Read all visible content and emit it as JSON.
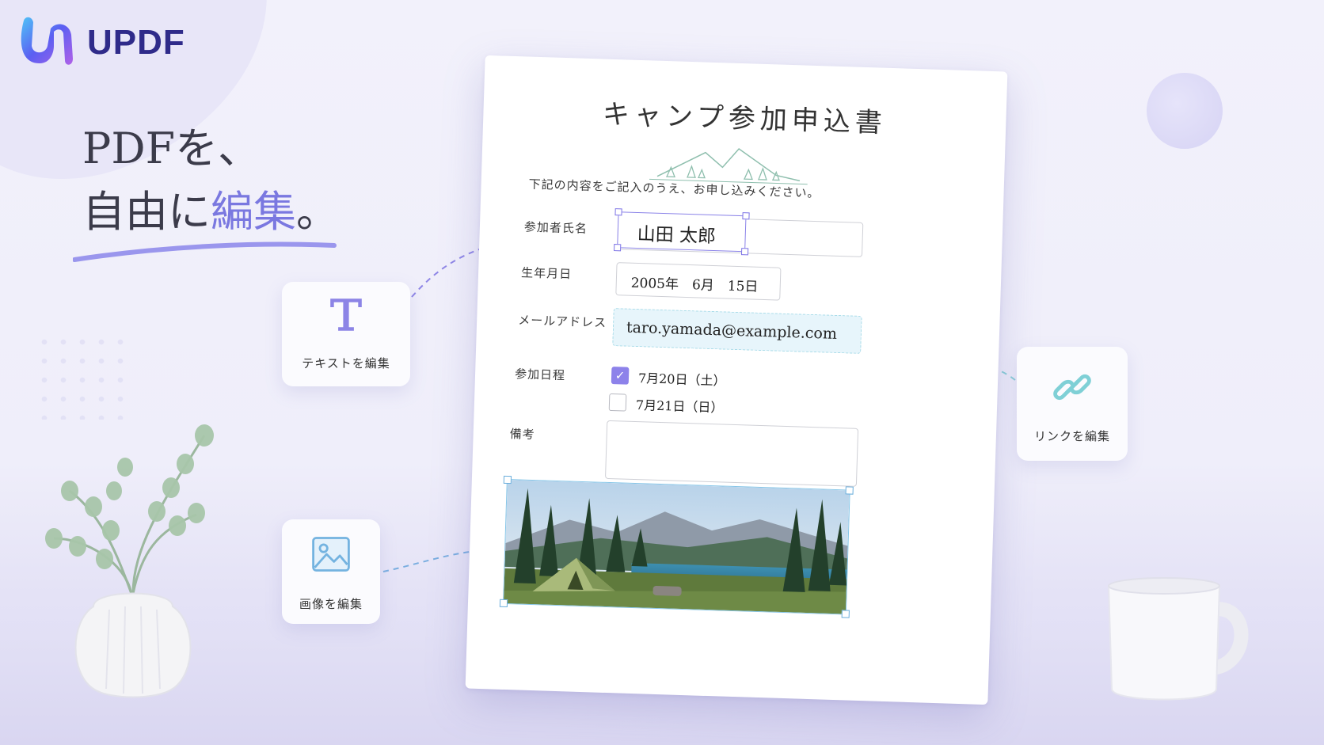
{
  "brand": {
    "logo_text": "UPDF",
    "accent_color": "#7a78e0",
    "brand_color": "#2f2b8a"
  },
  "headline": {
    "line1": "PDFを、",
    "line2_plain": "自由に",
    "line2_accent": "編集",
    "line2_end": "。"
  },
  "document": {
    "title": "キャンプ参加申込書",
    "intro": "下記の内容をご記入のうえ、お申し込みください。",
    "fields": {
      "name_label": "参加者氏名",
      "name_value": "山田 太郎",
      "birth_label": "生年月日",
      "birth_value": "2005年　6月　15日",
      "email_label": "メールアドレス",
      "email_value": "taro.yamada@example.com",
      "schedule_label": "参加日程",
      "option1": "7月20日（土）",
      "option1_checked": true,
      "option2": "7月21日（日）",
      "option2_checked": false,
      "notes_label": "備考"
    },
    "photo_icon": "camping-lake-photo"
  },
  "tools": {
    "text": {
      "label": "テキストを編集",
      "icon": "text-t-icon"
    },
    "link": {
      "label": "リンクを編集",
      "icon": "chain-link-icon"
    },
    "image": {
      "label": "画像を編集",
      "icon": "image-icon"
    }
  }
}
